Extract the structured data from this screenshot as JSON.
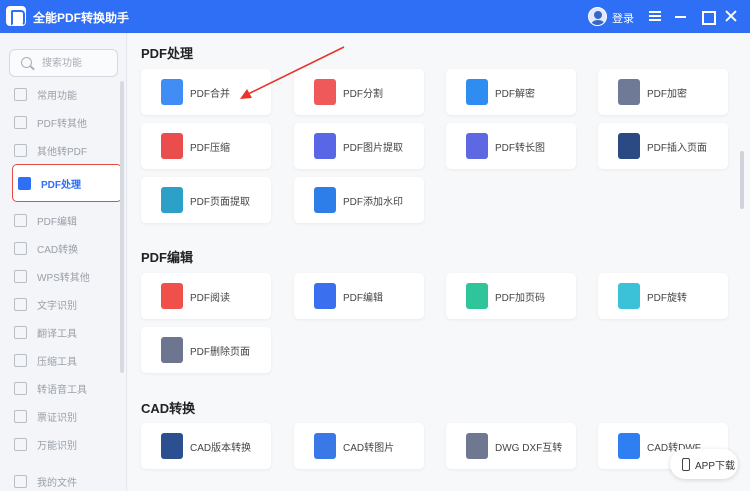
{
  "window": {
    "title": "全能PDF转换助手",
    "login_label": "登录"
  },
  "search": {
    "placeholder": "搜索功能"
  },
  "sidebar": {
    "items": [
      {
        "label": "常用功能",
        "icon": "grid-icon"
      },
      {
        "label": "PDF转其他",
        "icon": "pdf-convert-icon"
      },
      {
        "label": "其他转PDF",
        "icon": "to-pdf-icon"
      },
      {
        "label": "PDF处理",
        "icon": "pdf-process-icon",
        "active": true
      },
      {
        "label": "PDF编辑",
        "icon": "pdf-edit-icon"
      },
      {
        "label": "CAD转换",
        "icon": "cad-icon"
      },
      {
        "label": "WPS转其他",
        "icon": "wps-icon"
      },
      {
        "label": "文字识别",
        "icon": "ocr-icon"
      },
      {
        "label": "翻译工具",
        "icon": "translate-icon"
      },
      {
        "label": "压缩工具",
        "icon": "compress-icon"
      },
      {
        "label": "转语音工具",
        "icon": "speech-icon"
      },
      {
        "label": "票证识别",
        "icon": "ticket-icon"
      },
      {
        "label": "万能识别",
        "icon": "universal-ocr-icon"
      },
      {
        "label": "我的文件",
        "icon": "folder-icon"
      }
    ]
  },
  "sections": [
    {
      "title": "PDF处理",
      "cards": [
        {
          "label": "PDF合并",
          "icon": "merge-icon",
          "color": "#3f8df5"
        },
        {
          "label": "PDF分割",
          "icon": "split-icon",
          "color": "#f0595a"
        },
        {
          "label": "PDF解密",
          "icon": "unlock-icon",
          "color": "#2f8cf0"
        },
        {
          "label": "PDF加密",
          "icon": "lock-icon",
          "color": "#6f7a96"
        },
        {
          "label": "PDF压缩",
          "icon": "zip-icon",
          "color": "#ea4d4d"
        },
        {
          "label": "PDF图片提取",
          "icon": "image-extract-icon",
          "color": "#5966e6"
        },
        {
          "label": "PDF转长图",
          "icon": "long-image-icon",
          "color": "#5d68e2"
        },
        {
          "label": "PDF插入页面",
          "icon": "insert-page-icon",
          "color": "#2b4a84"
        },
        {
          "label": "PDF页面提取",
          "icon": "page-extract-icon",
          "color": "#2da0c8"
        },
        {
          "label": "PDF添加水印",
          "icon": "watermark-icon",
          "color": "#2d7ee8"
        }
      ]
    },
    {
      "title": "PDF编辑",
      "cards": [
        {
          "label": "PDF阅读",
          "icon": "read-icon",
          "color": "#f0504a"
        },
        {
          "label": "PDF编辑",
          "icon": "edit-icon",
          "color": "#3a6ff0"
        },
        {
          "label": "PDF加页码",
          "icon": "add-page-number-icon",
          "color": "#2fc59a"
        },
        {
          "label": "PDF旋转",
          "icon": "rotate-icon",
          "color": "#3cc2d8"
        },
        {
          "label": "PDF删除页面",
          "icon": "delete-page-icon",
          "color": "#6d7591"
        }
      ]
    },
    {
      "title": "CAD转换",
      "cards": [
        {
          "label": "CAD版本转换",
          "icon": "cad-version-icon",
          "color": "#2c4f8f"
        },
        {
          "label": "CAD转图片",
          "icon": "cad-image-icon",
          "color": "#3a78e8"
        },
        {
          "label": "DWG DXF互转",
          "icon": "dwg-dxf-icon",
          "color": "#6e7891"
        },
        {
          "label": "CAD转DWF",
          "icon": "cad-dwf-icon",
          "color": "#2f7ff2"
        }
      ]
    }
  ],
  "app_download": {
    "label": "APP下载"
  }
}
